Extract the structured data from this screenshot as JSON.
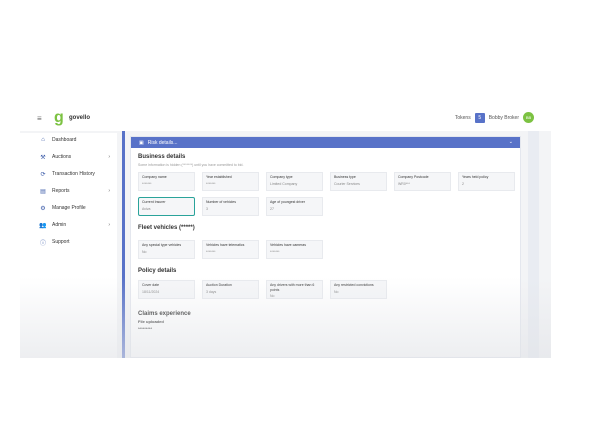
{
  "header": {
    "logo_text": "govello",
    "tokens_label": "Tokens",
    "tokens_count": "5",
    "user_name": "Bobby Broker",
    "avatar_initials": "BB"
  },
  "sidebar": {
    "items": [
      {
        "label": "Dashboard",
        "icon": "home-icon",
        "glyph": "⌂",
        "chevron": false
      },
      {
        "label": "Auctions",
        "icon": "gavel-icon",
        "glyph": "⚒",
        "chevron": true
      },
      {
        "label": "Transaction History",
        "icon": "history-icon",
        "glyph": "⟳",
        "chevron": false
      },
      {
        "label": "Reports",
        "icon": "report-icon",
        "glyph": "▤",
        "chevron": true
      },
      {
        "label": "Manage Profile",
        "icon": "gear-icon",
        "glyph": "⚙",
        "chevron": false
      },
      {
        "label": "Admin",
        "icon": "users-icon",
        "glyph": "👥",
        "chevron": true
      },
      {
        "label": "Support",
        "icon": "info-icon",
        "glyph": "ⓘ",
        "chevron": false
      }
    ]
  },
  "panel": {
    "title": "Risk details..."
  },
  "business": {
    "title": "Business details",
    "note": "Some information is hidden (*******) until you have committed to bid.",
    "row1": [
      {
        "label": "Company name",
        "value": "*******"
      },
      {
        "label": "Year established",
        "value": "*******"
      },
      {
        "label": "Company type",
        "value": "Limited Company"
      },
      {
        "label": "Business type",
        "value": "Courier Services"
      },
      {
        "label": "Company Postcode",
        "value": "WR0***"
      },
      {
        "label": "Years held policy",
        "value": "2"
      }
    ],
    "row2": [
      {
        "label": "Current Insurer",
        "value": "Aviva"
      },
      {
        "label": "Number of vehicles",
        "value": "3"
      },
      {
        "label": "Age of youngest driver",
        "value": "27"
      }
    ]
  },
  "fleet": {
    "title": "Fleet vehicles (*****)",
    "fields": [
      {
        "label": "Any special type vehicles",
        "value": "No"
      },
      {
        "label": "Vehicles have telematics",
        "value": "*******"
      },
      {
        "label": "Vehicles have cameras",
        "value": "*******"
      }
    ]
  },
  "policy": {
    "title": "Policy details",
    "fields": [
      {
        "label": "Cover date",
        "value": "18/11/2024"
      },
      {
        "label": "Auction Duration",
        "value": "3 days"
      },
      {
        "label": "Any drivers with more than 6 points",
        "value": "No"
      },
      {
        "label": "Any restricted convictions",
        "value": "No"
      }
    ]
  },
  "claims": {
    "title": "Claims experience",
    "sub": "File uploaded",
    "value": "*********"
  },
  "colors": {
    "accent": "#5872c8",
    "brand_green": "#7cc242",
    "highlight": "#2aa39a"
  }
}
